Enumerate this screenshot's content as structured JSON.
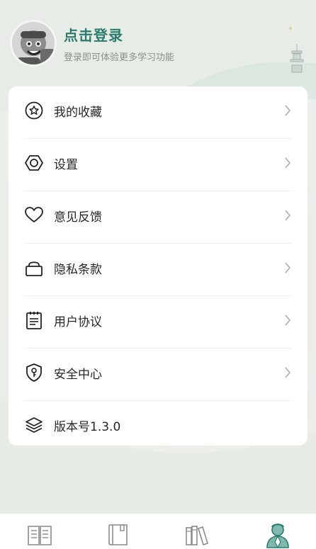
{
  "header": {
    "title": "点击登录",
    "subtitle": "登录即可体验更多学习功能"
  },
  "menu": {
    "items": [
      {
        "label": "我的收藏",
        "icon": "star-circle-icon",
        "has_chevron": true
      },
      {
        "label": "设置",
        "icon": "hexagon-settings-icon",
        "has_chevron": true
      },
      {
        "label": "意见反馈",
        "icon": "heart-icon",
        "has_chevron": true
      },
      {
        "label": "隐私条款",
        "icon": "lock-icon",
        "has_chevron": true
      },
      {
        "label": "用户协议",
        "icon": "clipboard-icon",
        "has_chevron": true
      },
      {
        "label": "安全中心",
        "icon": "shield-key-icon",
        "has_chevron": true
      },
      {
        "label": "版本号1.3.0",
        "icon": "layers-icon",
        "has_chevron": false
      }
    ]
  },
  "tabbar": {
    "tabs": [
      {
        "icon": "open-book-icon",
        "selected": false
      },
      {
        "icon": "closed-book-icon",
        "selected": false
      },
      {
        "icon": "bookshelf-icon",
        "selected": false
      },
      {
        "icon": "profile-character-icon",
        "selected": true
      }
    ]
  },
  "colors": {
    "accent": "#2b7a6d",
    "subtitle": "#8b8f8c",
    "card": "#ffffff",
    "background": "#eef2ec"
  }
}
